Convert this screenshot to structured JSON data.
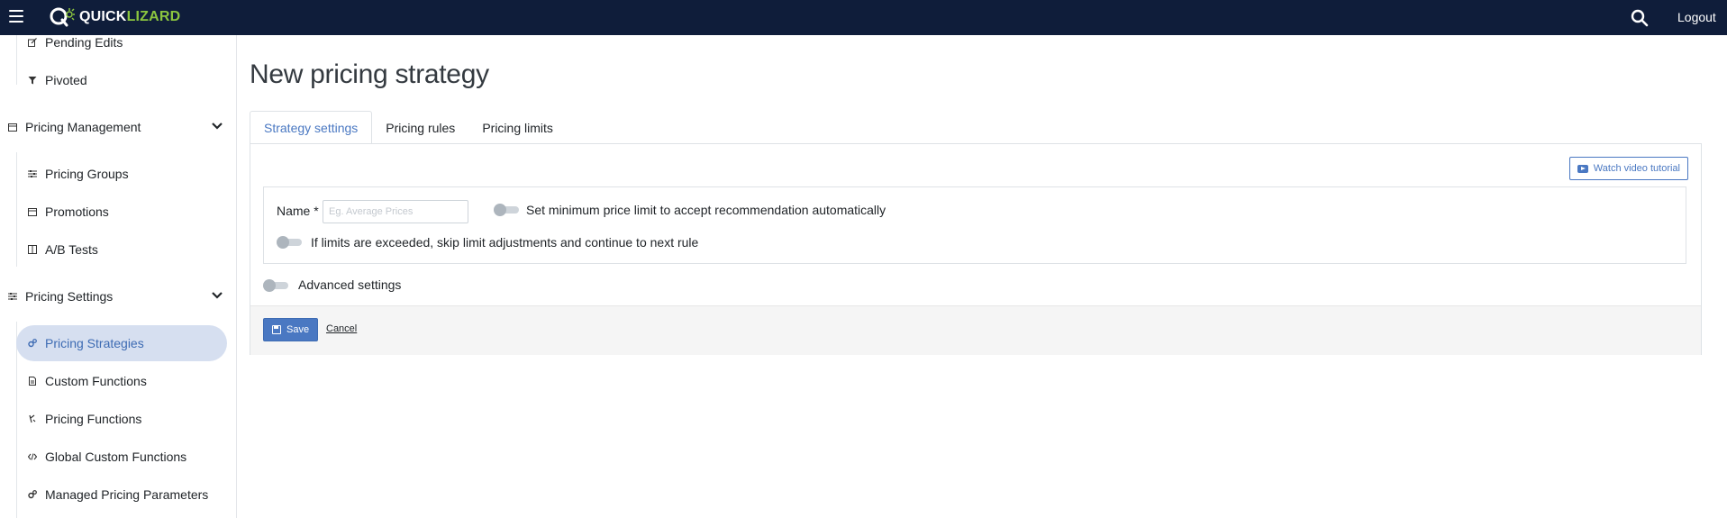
{
  "topbar": {
    "logo_quick": "QUICK",
    "logo_lizard": "LIZARD",
    "logout_label": "Logout"
  },
  "sidebar": {
    "items": [
      {
        "label": "Pending Edits",
        "icon": "edit-icon"
      },
      {
        "label": "Pivoted",
        "icon": "filter-icon"
      },
      {
        "label": "Pricing Management",
        "icon": "calendar-icon",
        "group": true
      },
      {
        "label": "Pricing Groups",
        "icon": "sliders-icon"
      },
      {
        "label": "Promotions",
        "icon": "calendar-icon"
      },
      {
        "label": "A/B Tests",
        "icon": "columns-icon"
      },
      {
        "label": "Pricing Settings",
        "icon": "sliders-icon",
        "group": true
      },
      {
        "label": "Pricing Strategies",
        "icon": "cogs-icon",
        "active": true
      },
      {
        "label": "Custom Functions",
        "icon": "file-icon"
      },
      {
        "label": "Pricing Functions",
        "icon": "function-icon"
      },
      {
        "label": "Global Custom Functions",
        "icon": "code-icon"
      },
      {
        "label": "Managed Pricing Parameters",
        "icon": "cogs-icon"
      }
    ]
  },
  "main": {
    "title": "New pricing strategy",
    "tabs": [
      {
        "label": "Strategy settings",
        "active": true
      },
      {
        "label": "Pricing rules"
      },
      {
        "label": "Pricing limits"
      }
    ],
    "watch_tutorial_label": "Watch video tutorial",
    "name_label": "Name *",
    "name_placeholder": "Eg. Average Prices",
    "name_value": "",
    "toggle_min_price_label": "Set minimum price limit to accept recommendation automatically",
    "toggle_min_price_on": false,
    "toggle_skip_limits_label": "If limits are exceeded, skip limit adjustments and continue to next rule",
    "toggle_skip_limits_on": false,
    "toggle_advanced_label": "Advanced settings",
    "toggle_advanced_on": false,
    "save_label": "Save",
    "cancel_label": "Cancel"
  },
  "colors": {
    "topbar": "#0f1d3a",
    "accent": "#4a78c2",
    "active_item_bg": "#d6dff0",
    "logo_green": "#8cc63f"
  }
}
